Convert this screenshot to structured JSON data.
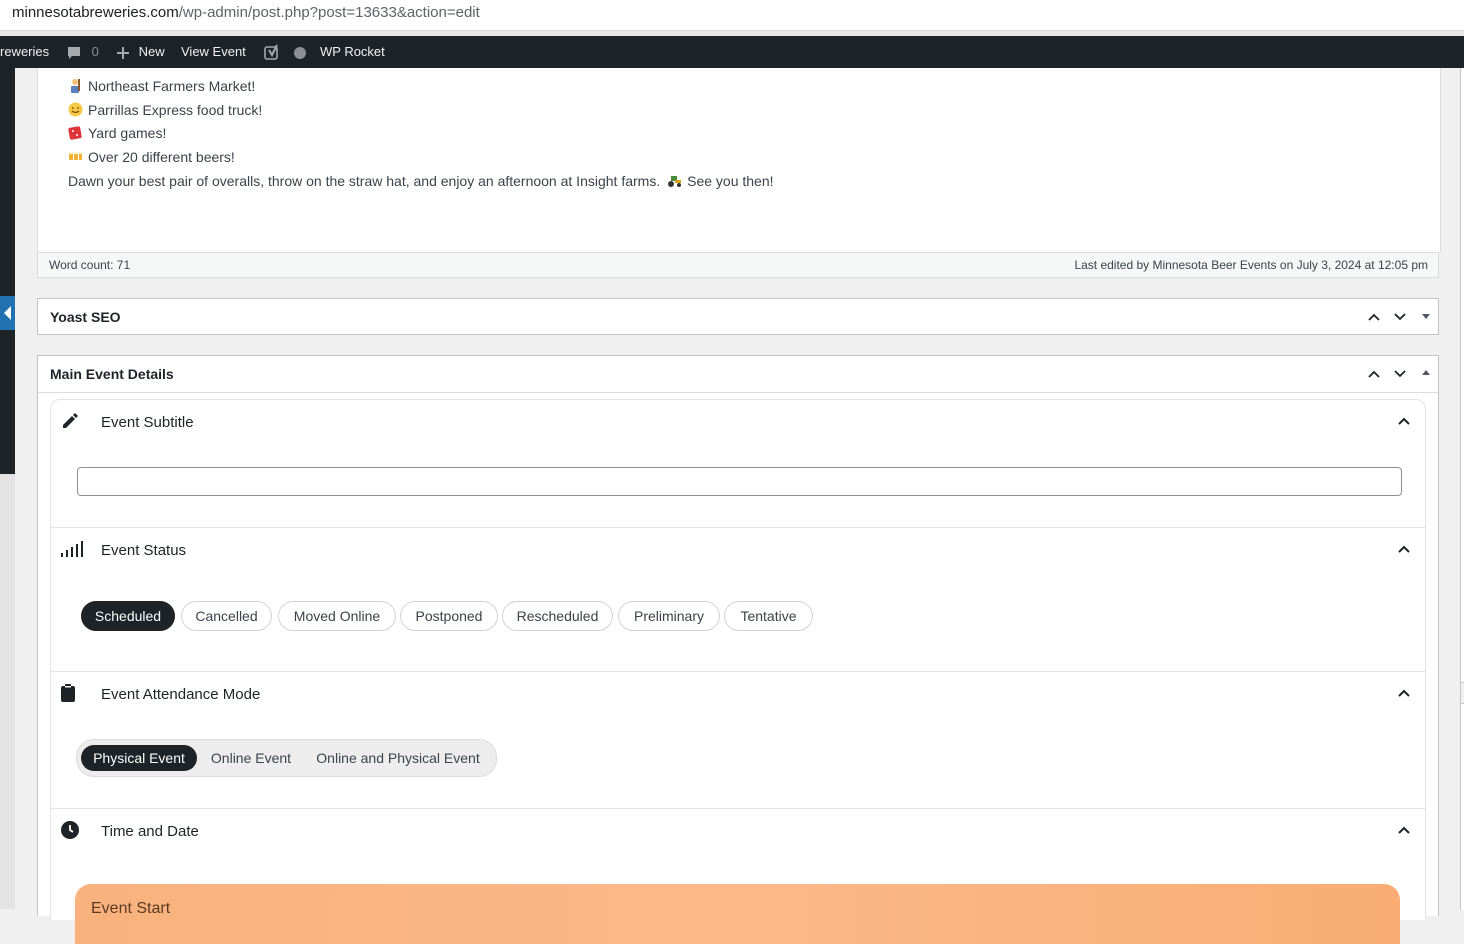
{
  "browser": {
    "url_domain": "minnesotabreweries.com",
    "url_path": "/wp-admin/post.php?post=13633&action=edit"
  },
  "adminbar": {
    "site_name": "reweries",
    "comments_count": "0",
    "new_label": "New",
    "view_label": "View Event",
    "rocket_label": "WP Rocket"
  },
  "editor": {
    "lines": [
      "Northeast Farmers Market!",
      "Parrillas Express food truck!",
      "Yard games!",
      "Over 20 different beers!",
      "Dawn your best pair of overalls, throw on the straw hat, and enjoy an afternoon at Insight farms.",
      "See you then!"
    ],
    "word_count": "Word count: 71",
    "last_edited": "Last edited by Minnesota Beer Events on July 3, 2024 at 12:05 pm"
  },
  "yoast": {
    "title": "Yoast SEO"
  },
  "main_event": {
    "title": "Main Event Details",
    "subtitle_section": {
      "title": "Event Subtitle",
      "value": ""
    },
    "status_section": {
      "title": "Event Status",
      "options": [
        "Scheduled",
        "Cancelled",
        "Moved Online",
        "Postponed",
        "Rescheduled",
        "Preliminary",
        "Tentative"
      ],
      "selected": "Scheduled"
    },
    "attendance_section": {
      "title": "Event Attendance Mode",
      "options": [
        "Physical Event",
        "Online Event",
        "Online and Physical Event"
      ],
      "selected": "Physical Event"
    },
    "time_section": {
      "title": "Time and Date",
      "event_start_label": "Event Start"
    }
  },
  "colors": {
    "adminbar_bg": "#1d2327",
    "accent_blue": "#2271b1",
    "pill_active": "#1d2327",
    "event_start_gradient": "#f9b27d"
  },
  "icons": [
    "comment-icon",
    "plus-icon",
    "yoast-icon",
    "status-dot-icon",
    "pencil-icon",
    "signal-icon",
    "clipboard-icon",
    "clock-icon",
    "chevron-up-icon",
    "chevron-down-icon",
    "triangle-down-icon",
    "triangle-up-icon"
  ]
}
